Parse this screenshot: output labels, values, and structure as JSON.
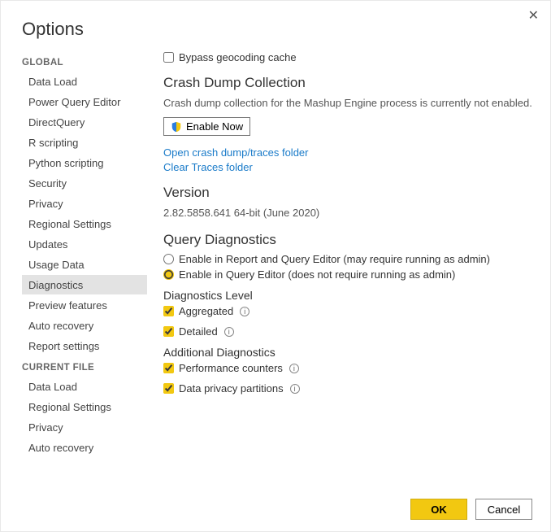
{
  "window": {
    "title": "Options"
  },
  "sidebar": {
    "groups": [
      {
        "label": "GLOBAL",
        "items": [
          {
            "label": "Data Load",
            "selected": false
          },
          {
            "label": "Power Query Editor",
            "selected": false
          },
          {
            "label": "DirectQuery",
            "selected": false
          },
          {
            "label": "R scripting",
            "selected": false
          },
          {
            "label": "Python scripting",
            "selected": false
          },
          {
            "label": "Security",
            "selected": false
          },
          {
            "label": "Privacy",
            "selected": false
          },
          {
            "label": "Regional Settings",
            "selected": false
          },
          {
            "label": "Updates",
            "selected": false
          },
          {
            "label": "Usage Data",
            "selected": false
          },
          {
            "label": "Diagnostics",
            "selected": true
          },
          {
            "label": "Preview features",
            "selected": false
          },
          {
            "label": "Auto recovery",
            "selected": false
          },
          {
            "label": "Report settings",
            "selected": false
          }
        ]
      },
      {
        "label": "CURRENT FILE",
        "items": [
          {
            "label": "Data Load",
            "selected": false
          },
          {
            "label": "Regional Settings",
            "selected": false
          },
          {
            "label": "Privacy",
            "selected": false
          },
          {
            "label": "Auto recovery",
            "selected": false
          }
        ]
      }
    ]
  },
  "main": {
    "bypass_geocoding": {
      "label": "Bypass geocoding cache",
      "checked": false
    },
    "crash_dump": {
      "heading": "Crash Dump Collection",
      "desc": "Crash dump collection for the Mashup Engine process is currently not enabled.",
      "enable_button": "Enable Now",
      "link_open": "Open crash dump/traces folder",
      "link_clear": "Clear Traces folder"
    },
    "version": {
      "heading": "Version",
      "value": "2.82.5858.641 64-bit (June 2020)"
    },
    "query_diag": {
      "heading": "Query Diagnostics",
      "opt_report": "Enable in Report and Query Editor (may require running as admin)",
      "opt_editor": "Enable in Query Editor (does not require running as admin)",
      "selected": "editor",
      "level_heading": "Diagnostics Level",
      "aggregated": {
        "label": "Aggregated",
        "checked": true
      },
      "detailed": {
        "label": "Detailed",
        "checked": true
      },
      "addl_heading": "Additional Diagnostics",
      "perf": {
        "label": "Performance counters",
        "checked": true
      },
      "privacy": {
        "label": "Data privacy partitions",
        "checked": true
      }
    }
  },
  "footer": {
    "ok": "OK",
    "cancel": "Cancel"
  }
}
